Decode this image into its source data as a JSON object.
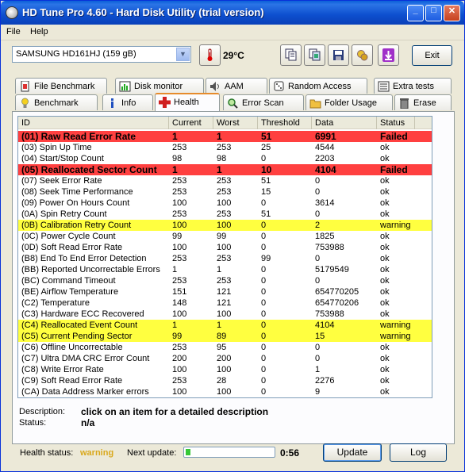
{
  "window": {
    "title": "HD Tune Pro 4.60 - Hard Disk Utility (trial version)",
    "minimize": "_",
    "maximize": "□",
    "close": "✕"
  },
  "menu": {
    "file": "File",
    "help": "Help"
  },
  "toolbar": {
    "drive": "SAMSUNG HD161HJ (159 gB)",
    "temperature": "29°C",
    "exit_label": "Exit"
  },
  "tabs_top": [
    {
      "label": "File Benchmark",
      "icon": "file-benchmark-icon"
    },
    {
      "label": "Disk monitor",
      "icon": "disk-monitor-icon"
    },
    {
      "label": "AAM",
      "icon": "speaker-icon"
    },
    {
      "label": "Random Access",
      "icon": "dice-icon"
    },
    {
      "label": "Extra tests",
      "icon": "extra-tests-icon"
    }
  ],
  "tabs_bottom": [
    {
      "label": "Benchmark",
      "icon": "lightbulb-icon"
    },
    {
      "label": "Info",
      "icon": "info-icon"
    },
    {
      "label": "Health",
      "icon": "health-cross-icon",
      "active": true
    },
    {
      "label": "Error Scan",
      "icon": "magnifier-icon"
    },
    {
      "label": "Folder Usage",
      "icon": "folder-icon"
    },
    {
      "label": "Erase",
      "icon": "trash-icon"
    }
  ],
  "table": {
    "headers": [
      "ID",
      "Current",
      "Worst",
      "Threshold",
      "Data",
      "Status"
    ],
    "rows": [
      {
        "id": "(01) Raw Read Error Rate",
        "current": "1",
        "worst": "1",
        "threshold": "51",
        "data": "6991",
        "status": "Failed",
        "level": "failed"
      },
      {
        "id": "(03) Spin Up Time",
        "current": "253",
        "worst": "253",
        "threshold": "25",
        "data": "4544",
        "status": "ok",
        "level": "ok"
      },
      {
        "id": "(04) Start/Stop Count",
        "current": "98",
        "worst": "98",
        "threshold": "0",
        "data": "2203",
        "status": "ok",
        "level": "ok"
      },
      {
        "id": "(05) Reallocated Sector Count",
        "current": "1",
        "worst": "1",
        "threshold": "10",
        "data": "4104",
        "status": "Failed",
        "level": "failed"
      },
      {
        "id": "(07) Seek Error Rate",
        "current": "253",
        "worst": "253",
        "threshold": "51",
        "data": "0",
        "status": "ok",
        "level": "ok"
      },
      {
        "id": "(08) Seek Time Performance",
        "current": "253",
        "worst": "253",
        "threshold": "15",
        "data": "0",
        "status": "ok",
        "level": "ok"
      },
      {
        "id": "(09) Power On Hours Count",
        "current": "100",
        "worst": "100",
        "threshold": "0",
        "data": "3614",
        "status": "ok",
        "level": "ok"
      },
      {
        "id": "(0A) Spin Retry Count",
        "current": "253",
        "worst": "253",
        "threshold": "51",
        "data": "0",
        "status": "ok",
        "level": "ok"
      },
      {
        "id": "(0B) Calibration Retry Count",
        "current": "100",
        "worst": "100",
        "threshold": "0",
        "data": "2",
        "status": "warning",
        "level": "warning"
      },
      {
        "id": "(0C) Power Cycle Count",
        "current": "99",
        "worst": "99",
        "threshold": "0",
        "data": "1825",
        "status": "ok",
        "level": "ok"
      },
      {
        "id": "(0D) Soft Read Error Rate",
        "current": "100",
        "worst": "100",
        "threshold": "0",
        "data": "753988",
        "status": "ok",
        "level": "ok"
      },
      {
        "id": "(B8) End To End Error Detection",
        "current": "253",
        "worst": "253",
        "threshold": "99",
        "data": "0",
        "status": "ok",
        "level": "ok"
      },
      {
        "id": "(BB) Reported Uncorrectable Errors",
        "current": "1",
        "worst": "1",
        "threshold": "0",
        "data": "5179549",
        "status": "ok",
        "level": "ok"
      },
      {
        "id": "(BC) Command Timeout",
        "current": "253",
        "worst": "253",
        "threshold": "0",
        "data": "0",
        "status": "ok",
        "level": "ok"
      },
      {
        "id": "(BE) Airflow Temperature",
        "current": "151",
        "worst": "121",
        "threshold": "0",
        "data": "654770205",
        "status": "ok",
        "level": "ok"
      },
      {
        "id": "(C2) Temperature",
        "current": "148",
        "worst": "121",
        "threshold": "0",
        "data": "654770206",
        "status": "ok",
        "level": "ok"
      },
      {
        "id": "(C3) Hardware ECC Recovered",
        "current": "100",
        "worst": "100",
        "threshold": "0",
        "data": "753988",
        "status": "ok",
        "level": "ok"
      },
      {
        "id": "(C4) Reallocated Event Count",
        "current": "1",
        "worst": "1",
        "threshold": "0",
        "data": "4104",
        "status": "warning",
        "level": "warning"
      },
      {
        "id": "(C5) Current Pending Sector",
        "current": "99",
        "worst": "89",
        "threshold": "0",
        "data": "15",
        "status": "warning",
        "level": "warning"
      },
      {
        "id": "(C6) Offline Uncorrectable",
        "current": "253",
        "worst": "95",
        "threshold": "0",
        "data": "0",
        "status": "ok",
        "level": "ok"
      },
      {
        "id": "(C7) Ultra DMA CRC Error Count",
        "current": "200",
        "worst": "200",
        "threshold": "0",
        "data": "0",
        "status": "ok",
        "level": "ok"
      },
      {
        "id": "(C8) Write Error Rate",
        "current": "100",
        "worst": "100",
        "threshold": "0",
        "data": "1",
        "status": "ok",
        "level": "ok"
      },
      {
        "id": "(C9) Soft Read Error Rate",
        "current": "253",
        "worst": "28",
        "threshold": "0",
        "data": "2276",
        "status": "ok",
        "level": "ok"
      },
      {
        "id": "(CA) Data Address Marker errors",
        "current": "100",
        "worst": "100",
        "threshold": "0",
        "data": "9",
        "status": "ok",
        "level": "ok"
      }
    ]
  },
  "details": {
    "description_label": "Description:",
    "description_value": "click on an item for a detailed description",
    "status_label": "Status:",
    "status_value": "n/a"
  },
  "footer": {
    "health_label": "Health status:",
    "health_value": "warning",
    "next_update_label": "Next update:",
    "progress_fraction": 0.05,
    "time_left": "0:56",
    "update_label": "Update",
    "log_label": "Log"
  },
  "colors": {
    "failed_row": "#ff4040",
    "warning_row": "#ffff40",
    "warning_text": "#d9a81c",
    "title_bar": "#0a5fd8"
  }
}
